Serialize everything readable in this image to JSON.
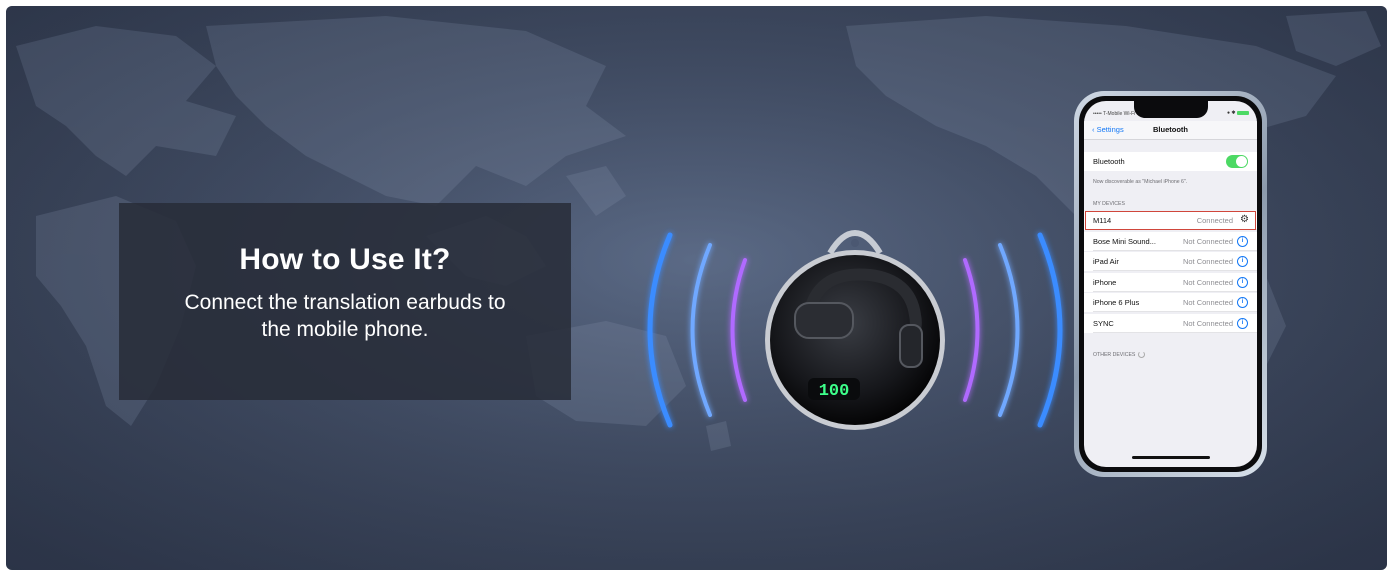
{
  "banner": {
    "title": "How to Use It?",
    "text": "Connect the translation earbuds to the mobile phone.",
    "colors": {
      "background": "#4b5872",
      "box": "#282c38",
      "waves_blue": "#3a8cff",
      "waves_purple": "#b06bff"
    }
  },
  "earbud_case": {
    "display": "100",
    "display_color": "#3dff8a"
  },
  "phone": {
    "status": {
      "carrier": "••••• T-Mobile Wi-Fi"
    },
    "nav": {
      "back": "Settings",
      "title": "Bluetooth"
    },
    "bluetooth": {
      "label": "Bluetooth",
      "enabled": true
    },
    "discoverable_note": "Now discoverable as \"Michael iPhone 6\".",
    "my_devices_header": "MY DEVICES",
    "devices": [
      {
        "name": "M114",
        "status": "Connected",
        "icon": "gear-icon"
      },
      {
        "name": "Bose Mini Sound...",
        "status": "Not Connected",
        "icon": "info-icon"
      },
      {
        "name": "iPad Air",
        "status": "Not Connected",
        "icon": "info-icon"
      },
      {
        "name": "iPhone",
        "status": "Not Connected",
        "icon": "info-icon"
      },
      {
        "name": "iPhone 6 Plus",
        "status": "Not Connected",
        "icon": "info-icon"
      },
      {
        "name": "SYNC",
        "status": "Not Connected",
        "icon": "info-icon"
      }
    ],
    "other_devices_header": "OTHER DEVICES"
  }
}
